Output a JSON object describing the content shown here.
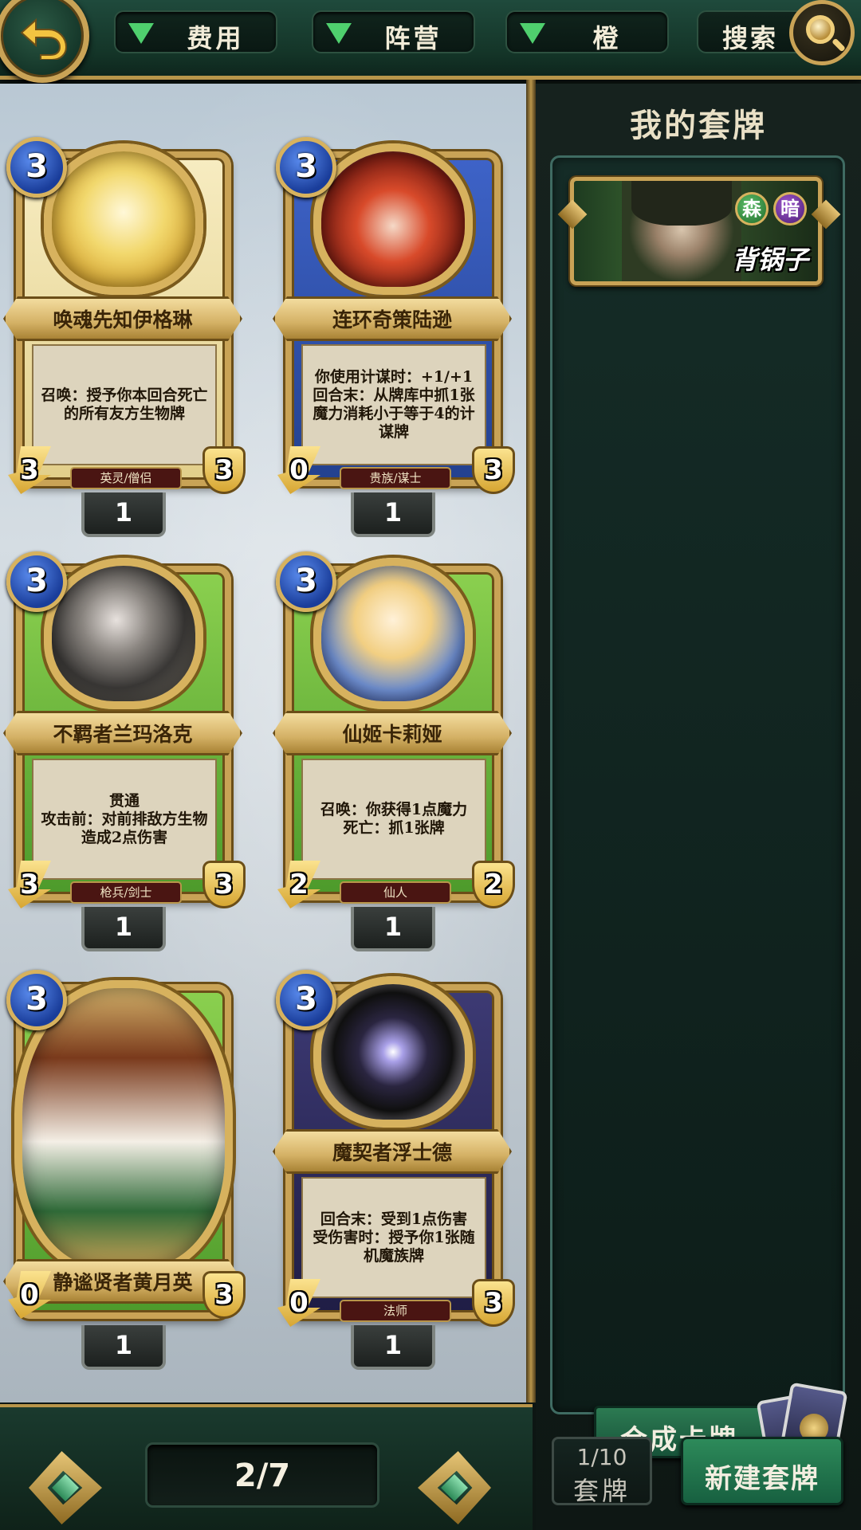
{
  "filters": {
    "cost_label": "费用",
    "faction_label": "阵营",
    "rarity_label": "橙",
    "search_label": "搜索"
  },
  "cards": [
    {
      "name": "唤魂先知伊格琳",
      "cost": "3",
      "attack": "3",
      "health": "3",
      "text": "召唤：授予你本回合死亡的所有友方生物牌",
      "tribe": "英灵/僧侣",
      "count": "1",
      "theme": "gold"
    },
    {
      "name": "连环奇策陆逊",
      "cost": "3",
      "attack": "0",
      "health": "3",
      "text": "你使用计谋时：+1/+1\n回合末：从牌库中抓1张魔力消耗小于等于4的计谋牌",
      "tribe": "贵族/谋士",
      "count": "1",
      "theme": "blue"
    },
    {
      "name": "不羁者兰玛洛克",
      "cost": "3",
      "attack": "3",
      "health": "3",
      "text": "贯通\n攻击前：对前排敌方生物造成2点伤害",
      "tribe": "枪兵/剑士",
      "count": "1",
      "theme": "green"
    },
    {
      "name": "仙姬卡莉娅",
      "cost": "3",
      "attack": "2",
      "health": "2",
      "text": "召唤：你获得1点魔力\n死亡：抓1张牌",
      "tribe": "仙人",
      "count": "1",
      "theme": "green"
    },
    {
      "name": "静谧贤者黄月英",
      "cost": "3",
      "attack": "0",
      "health": "3",
      "text": "",
      "tribe": "",
      "count": "1",
      "theme": "green"
    },
    {
      "name": "魔契者浮士德",
      "cost": "3",
      "attack": "0",
      "health": "3",
      "text": "回合末：受到1点伤害\n受伤害时：授予你1张随机魔族牌",
      "tribe": "法师",
      "count": "1",
      "theme": "dark"
    }
  ],
  "pager": {
    "page": "2/7"
  },
  "deck_panel": {
    "title": "我的套牌",
    "decks": [
      {
        "name": "背锅子",
        "factions": [
          "森",
          "暗"
        ]
      }
    ],
    "craft_label": "合成卡牌",
    "deck_count": "1/10",
    "deck_count_label": "套牌",
    "new_deck_label": "新建套牌"
  },
  "colors": {
    "accent_gold": "#c9a356",
    "panel_green": "#1f4a3c",
    "button_green": "#2d8a5a"
  },
  "icons": [
    "back-arrow-icon",
    "filter-triangle-icon",
    "search-magnifier-icon",
    "page-left-arrow-icon",
    "page-right-arrow-icon",
    "card-stack-icon"
  ]
}
